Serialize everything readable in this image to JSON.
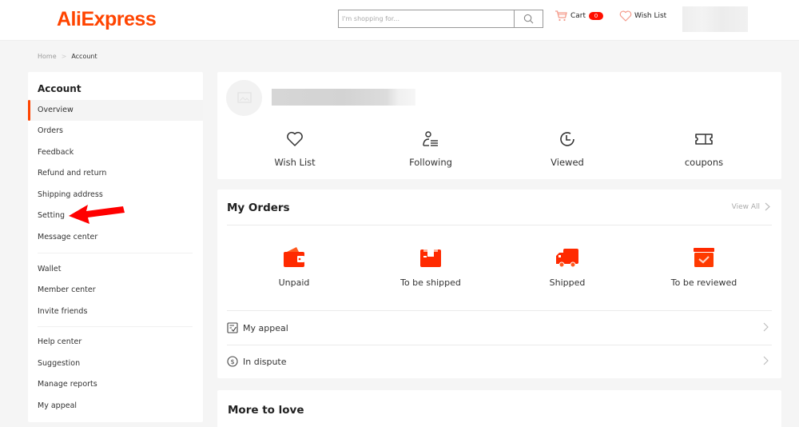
{
  "header": {
    "logo": "AliExpress",
    "search_placeholder": "I'm shopping for...",
    "cart_label": "Cart",
    "cart_count": "0",
    "wishlist_label": "Wish List"
  },
  "breadcrumb": {
    "home": "Home",
    "separator": ">",
    "current": "Account"
  },
  "sidebar": {
    "title": "Account",
    "groups": [
      [
        {
          "label": "Overview",
          "active": true
        },
        {
          "label": "Orders"
        },
        {
          "label": "Feedback"
        },
        {
          "label": "Refund and return"
        },
        {
          "label": "Shipping address"
        },
        {
          "label": "Setting"
        },
        {
          "label": "Message center"
        }
      ],
      [
        {
          "label": "Wallet"
        },
        {
          "label": "Member center"
        },
        {
          "label": "Invite friends"
        }
      ],
      [
        {
          "label": "Help center"
        },
        {
          "label": "Suggestion"
        },
        {
          "label": "Manage reports"
        },
        {
          "label": "My appeal"
        }
      ]
    ]
  },
  "profile": {
    "quick_links": [
      {
        "label": "Wish List",
        "icon": "heart-icon"
      },
      {
        "label": "Following",
        "icon": "following-icon"
      },
      {
        "label": "Viewed",
        "icon": "clock-icon"
      },
      {
        "label": "coupons",
        "icon": "coupon-icon"
      }
    ]
  },
  "orders": {
    "title": "My Orders",
    "view_all": "View All",
    "statuses": [
      {
        "label": "Unpaid",
        "icon": "wallet-icon"
      },
      {
        "label": "To be shipped",
        "icon": "package-icon"
      },
      {
        "label": "Shipped",
        "icon": "truck-icon"
      },
      {
        "label": "To be reviewed",
        "icon": "review-box-icon"
      }
    ],
    "rows": [
      {
        "label": "My appeal",
        "icon": "appeal-icon"
      },
      {
        "label": "In dispute",
        "icon": "dollar-circle-icon"
      }
    ]
  },
  "more": {
    "title": "More to love"
  },
  "colors": {
    "brand": "#ff4400",
    "badge": "#ff0f00",
    "icon_red": "#ff2a00",
    "annotation_arrow": "#ff0000"
  }
}
